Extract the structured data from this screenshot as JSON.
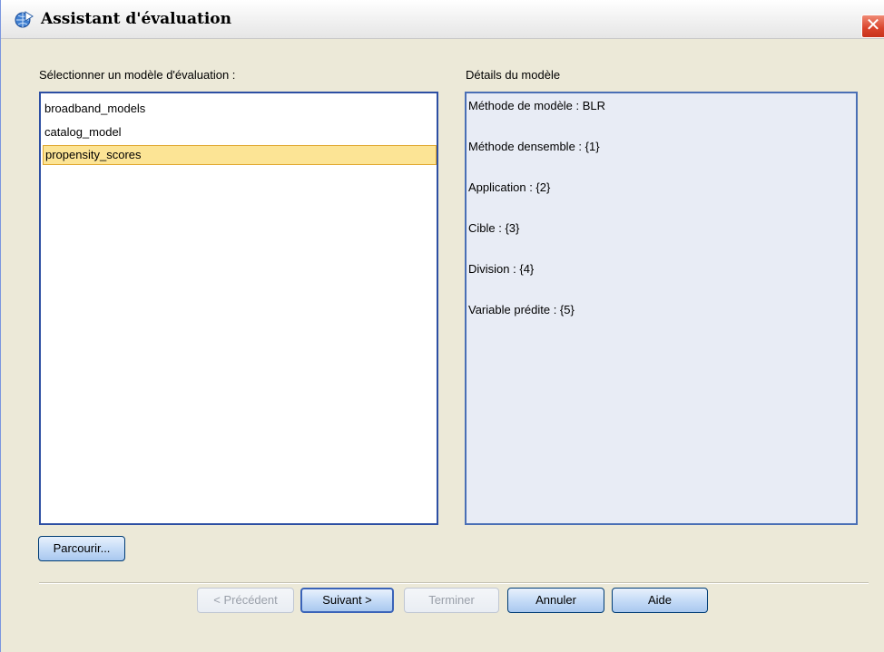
{
  "window": {
    "title": "Assistant d'évaluation",
    "icon": "globe-arrow-icon",
    "close_glyph": "✕"
  },
  "left_panel": {
    "label": "Sélectionner un modèle d'évaluation :",
    "items": [
      {
        "label": "broadband_models",
        "selected": false
      },
      {
        "label": "catalog_model",
        "selected": false
      },
      {
        "label": "propensity_scores",
        "selected": true
      }
    ]
  },
  "right_panel": {
    "label": "Détails du modèle",
    "lines": [
      "Méthode de modèle : BLR",
      "Méthode densemble : {1}",
      "Application : {2}",
      "Cible : {3}",
      "Division : {4}",
      "Variable prédite : {5}"
    ]
  },
  "buttons": {
    "browse": "Parcourir...",
    "previous": "< Précédent",
    "next": "Suivant >",
    "finish": "Terminer",
    "cancel": "Annuler",
    "help": "Aide"
  },
  "colors": {
    "selection": "#fce495",
    "list_border": "#2d4fa3",
    "dialog_bg": "#ece9d8"
  }
}
